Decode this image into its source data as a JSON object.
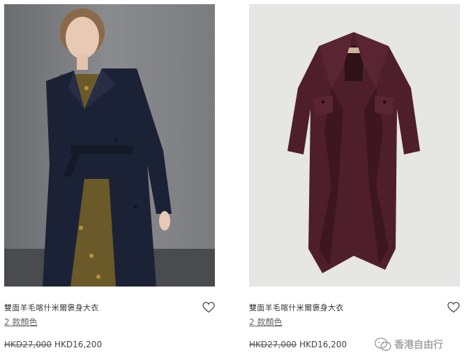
{
  "products": [
    {
      "title": "雙面羊毛喀什米爾褒身大衣",
      "colors_link": "2 款顏色",
      "original_price": "HKD27,000",
      "sale_price": "HKD16,200",
      "coat_color": "#1c2235"
    },
    {
      "title": "雙面羊毛喀什米爾褒身大衣",
      "colors_link": "2 款顏色",
      "original_price": "HKD27,000",
      "sale_price": "HKD16,200",
      "coat_color": "#4e1f2b"
    }
  ],
  "watermark": {
    "text": "香港自由行",
    "icon": "wechat-icon"
  }
}
